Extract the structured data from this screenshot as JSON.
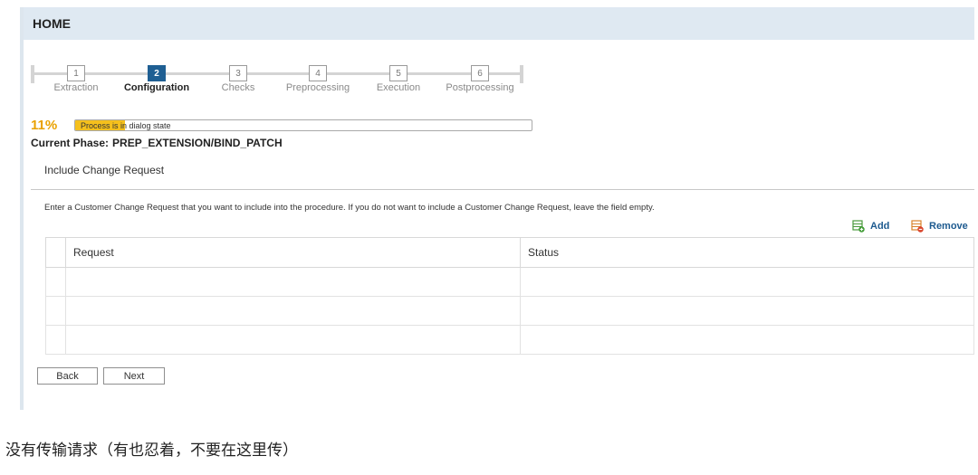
{
  "header": {
    "title": "HOME"
  },
  "wizard": {
    "steps": [
      {
        "number": "1",
        "label": "Extraction"
      },
      {
        "number": "2",
        "label": "Configuration"
      },
      {
        "number": "3",
        "label": "Checks"
      },
      {
        "number": "4",
        "label": "Preprocessing"
      },
      {
        "number": "5",
        "label": "Execution"
      },
      {
        "number": "6",
        "label": "Postprocessing"
      }
    ],
    "active_step": 2
  },
  "progress": {
    "percent_label": "11%",
    "fraction": 0.11,
    "status_text": "Process is in dialog state",
    "phase_label": "Current Phase:",
    "phase_value": "PREP_EXTENSION/BIND_PATCH"
  },
  "section": {
    "title": "Include Change Request",
    "instruction": "Enter a Customer Change Request that you want to include into the procedure. If you do not want to include a Customer Change Request, leave the field empty."
  },
  "table_toolbar": {
    "add_label": "Add",
    "remove_label": "Remove",
    "add_icon": "add-row-icon",
    "remove_icon": "remove-row-icon"
  },
  "table": {
    "columns": [
      "Request",
      "Status"
    ],
    "rows": [
      [
        "",
        ""
      ],
      [
        "",
        ""
      ],
      [
        "",
        ""
      ]
    ]
  },
  "footer": {
    "back_label": "Back",
    "next_label": "Next"
  },
  "caption": "没有传输请求（有也忍着，不要在这里传）",
  "colors": {
    "accent": "#1f5f93",
    "progress_fill": "#f5c01d",
    "percent": "#e9a100",
    "header_bg": "#dfe9f2"
  }
}
